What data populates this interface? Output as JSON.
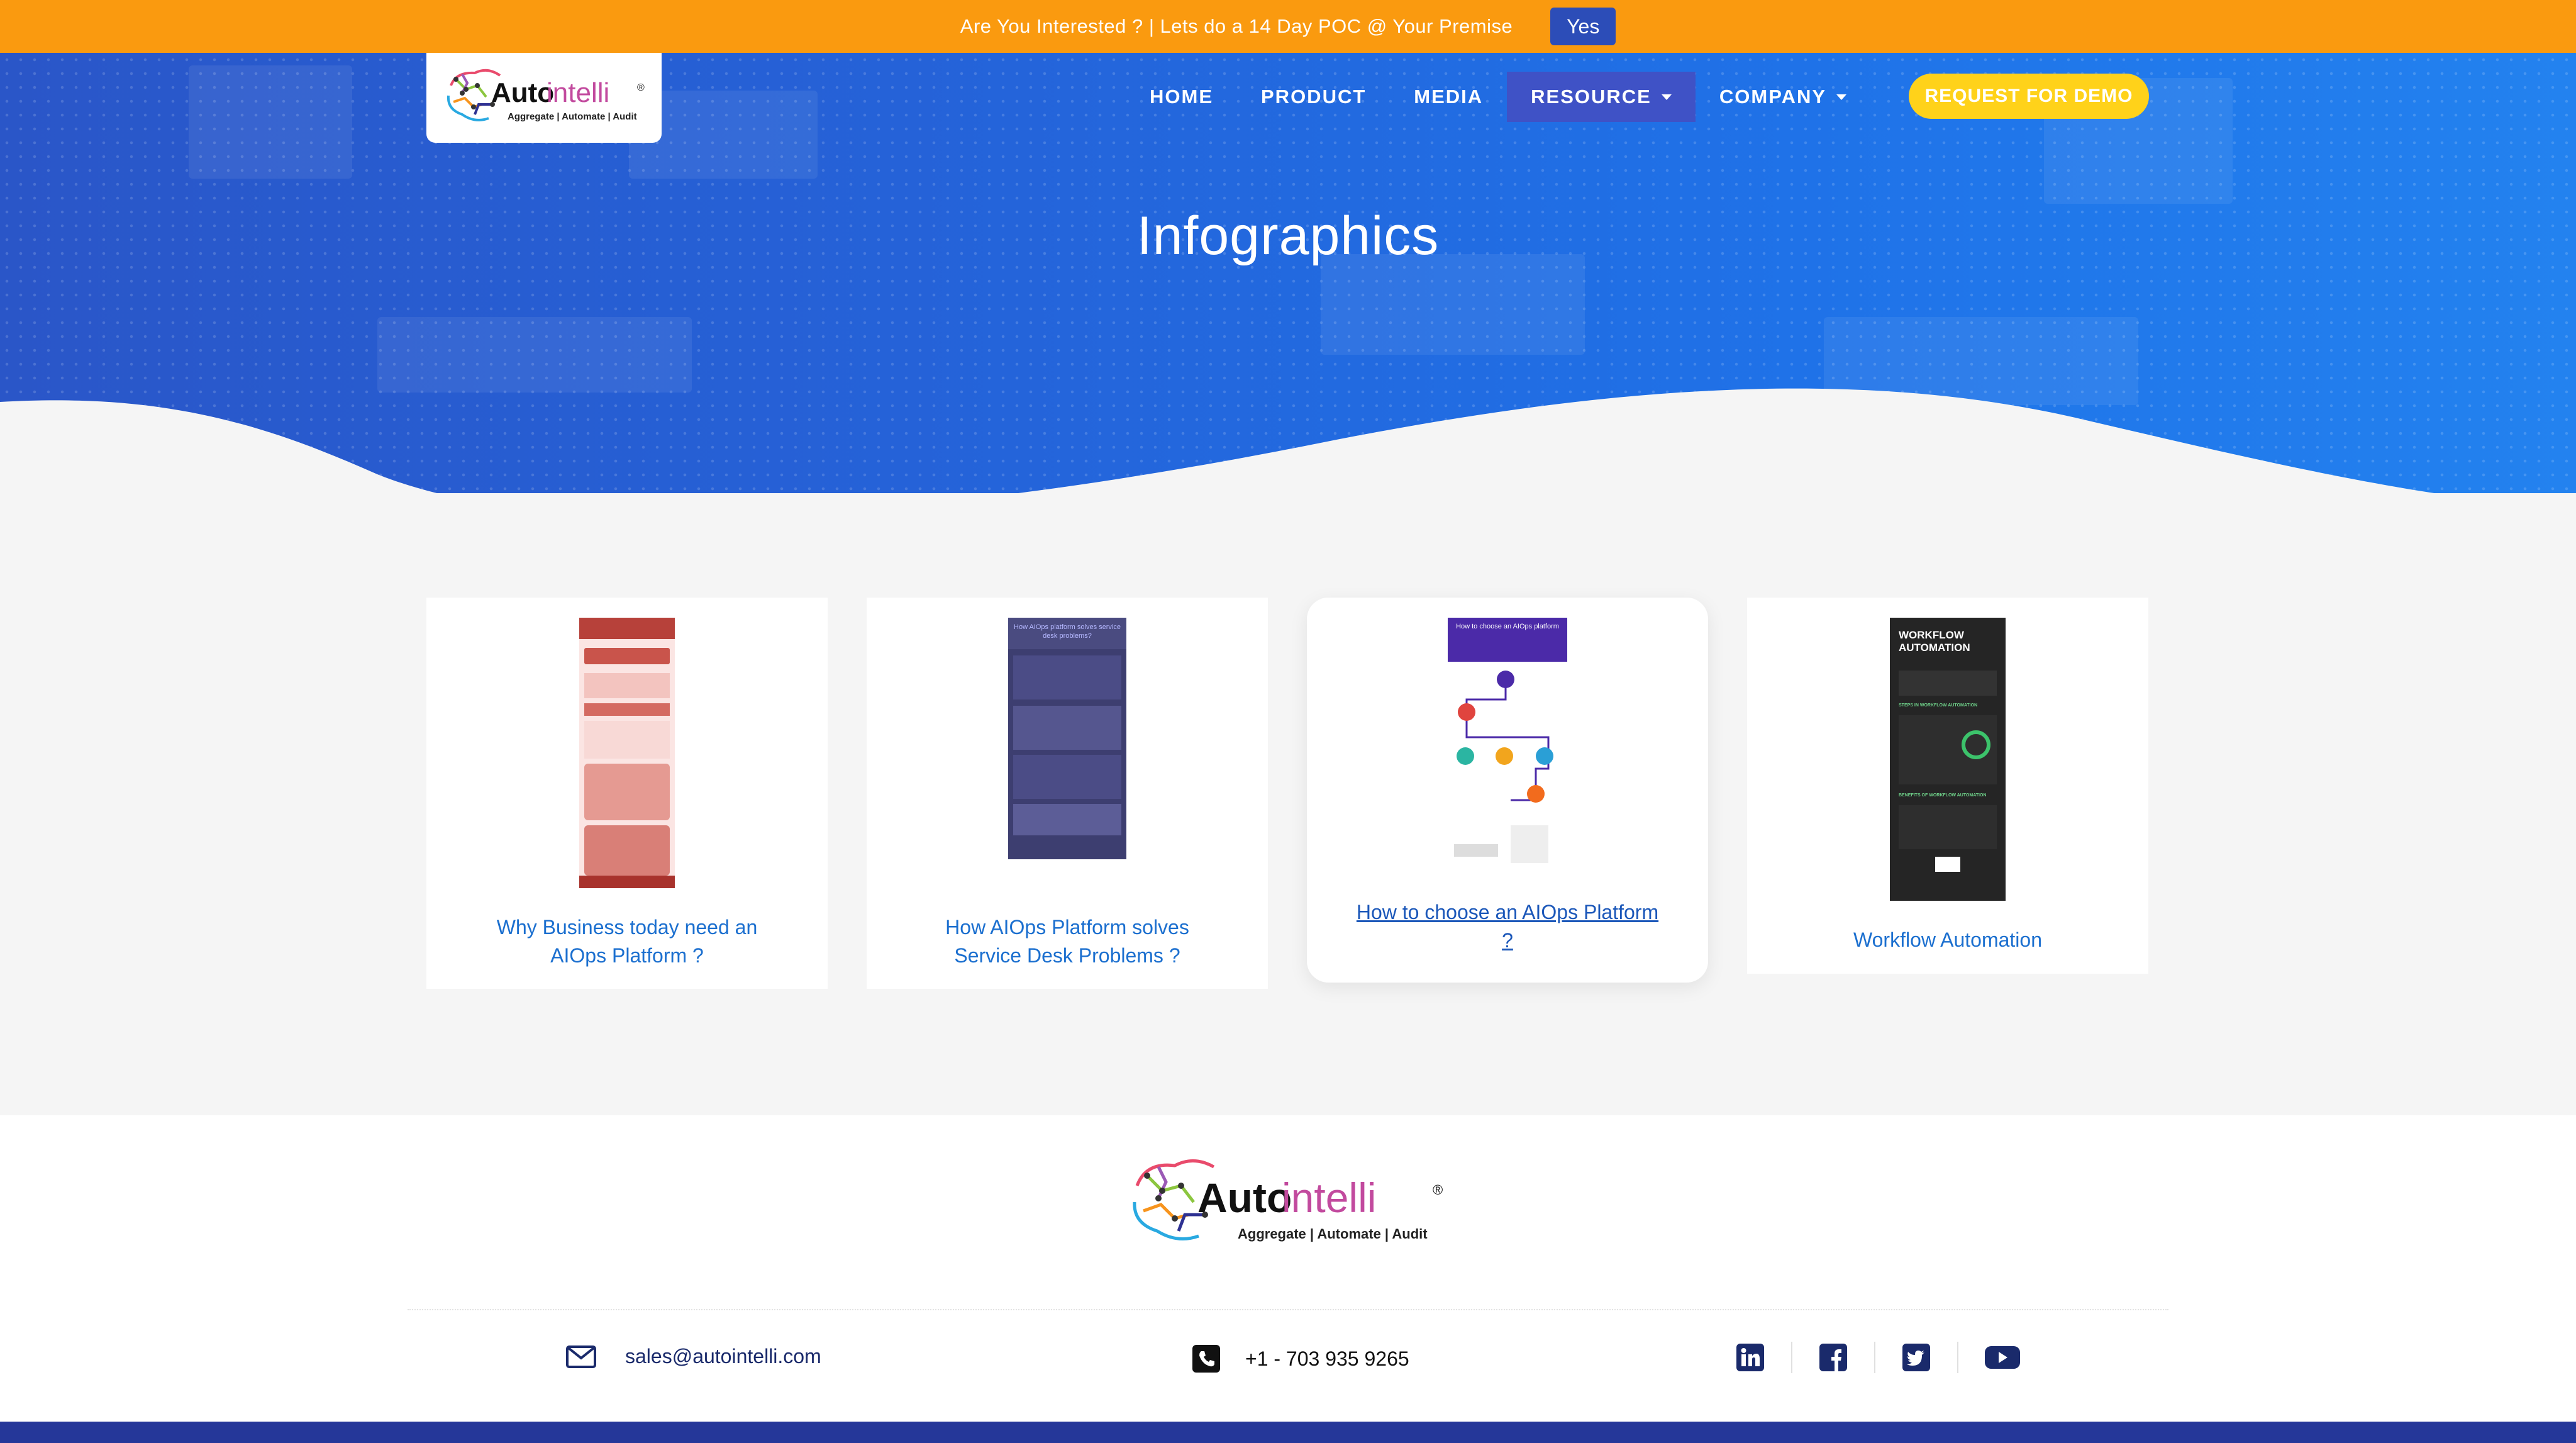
{
  "announcement": {
    "text": "Are You Interested ? | Lets do a 14 Day POC @ Your Premise",
    "button_label": "Yes"
  },
  "brand": {
    "name_auto": "Auto",
    "name_intelli": "intelli",
    "registered": "®",
    "tagline": "Aggregate | Automate | Audit"
  },
  "nav": {
    "items": [
      {
        "label": "HOME"
      },
      {
        "label": "PRODUCT"
      },
      {
        "label": "MEDIA"
      },
      {
        "label": "RESOURCE"
      },
      {
        "label": "COMPANY"
      }
    ],
    "demo_label": "REQUEST FOR DEMO"
  },
  "hero": {
    "title": "Infographics"
  },
  "cards": [
    {
      "title": "Why Business today need an AIOps Platform ?"
    },
    {
      "title": "How AIOps Platform solves Service Desk Problems ?"
    },
    {
      "title": "How to choose an AIOps Platform ?"
    },
    {
      "title": "Workflow Automation"
    }
  ],
  "thumbs": {
    "t2_heading": "How AIOps platform solves service desk problems?",
    "t3_heading": "How to choose an AIOps platform",
    "t4_heading": "WORKFLOW AUTOMATION",
    "t4_sub1": "STEPS IN WORKFLOW AUTOMATION",
    "t4_sub2": "BENEFITS OF WORKFLOW AUTOMATION"
  },
  "footer": {
    "email": "sales@autointelli.com",
    "phone": "+1 - 703 935 9265",
    "socials": [
      "linkedin-icon",
      "facebook-icon",
      "twitter-icon",
      "youtube-icon"
    ]
  },
  "colors": {
    "topbar": "#fa9a0f",
    "nav_active": "#3f52c6",
    "demo_button": "#ffd21a",
    "link": "#1b6fcf",
    "footer_icons": "#1a2a6b",
    "bottom_bar": "#253799"
  }
}
